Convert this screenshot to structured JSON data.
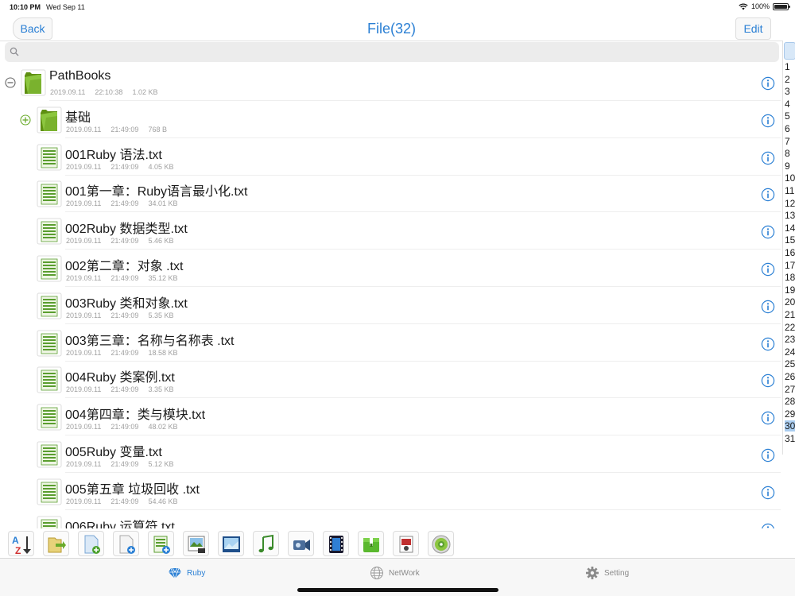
{
  "status": {
    "time": "10:10 PM",
    "date": "Wed Sep 11",
    "battery": "100%",
    "battery_level": 1.0
  },
  "nav": {
    "back_label": "Back",
    "title": "File(32)",
    "edit_label": "Edit"
  },
  "search": {
    "placeholder": ""
  },
  "colors": {
    "accent": "#2a7fd4",
    "folder_green": "#7cb518",
    "file_green": "#5a9e2f",
    "toggle_green": "#6aab2c"
  },
  "items": [
    {
      "kind": "folder",
      "toggle": "collapse",
      "name": "PathBooks",
      "date": "2019.09.11",
      "time": "22:10:38",
      "size": "1.02 KB",
      "level": 0
    },
    {
      "kind": "folder",
      "toggle": "expand",
      "name": "基础",
      "date": "2019.09.11",
      "time": "21:49:09",
      "size": "768 B",
      "level": 1
    },
    {
      "kind": "file",
      "name": "001Ruby 语法.txt",
      "date": "2019.09.11",
      "time": "21:49:09",
      "size": "4.05 KB",
      "level": 1
    },
    {
      "kind": "file",
      "name": "001第一章：Ruby语言最小化.txt",
      "date": "2019.09.11",
      "time": "21:49:09",
      "size": "34.01 KB",
      "level": 1
    },
    {
      "kind": "file",
      "name": "002Ruby 数据类型.txt",
      "date": "2019.09.11",
      "time": "21:49:09",
      "size": "5.46 KB",
      "level": 1
    },
    {
      "kind": "file",
      "name": "002第二章：对象 .txt",
      "date": "2019.09.11",
      "time": "21:49:09",
      "size": "35.12 KB",
      "level": 1
    },
    {
      "kind": "file",
      "name": "003Ruby 类和对象.txt",
      "date": "2019.09.11",
      "time": "21:49:09",
      "size": "5.35 KB",
      "level": 1
    },
    {
      "kind": "file",
      "name": "003第三章：名称与名称表 .txt",
      "date": "2019.09.11",
      "time": "21:49:09",
      "size": "18.58 KB",
      "level": 1
    },
    {
      "kind": "file",
      "name": "004Ruby 类案例.txt",
      "date": "2019.09.11",
      "time": "21:49:09",
      "size": "3.35 KB",
      "level": 1
    },
    {
      "kind": "file",
      "name": "004第四章：类与模块.txt",
      "date": "2019.09.11",
      "time": "21:49:09",
      "size": "48.02 KB",
      "level": 1
    },
    {
      "kind": "file",
      "name": "005Ruby 变量.txt",
      "date": "2019.09.11",
      "time": "21:49:09",
      "size": "5.12 KB",
      "level": 1
    },
    {
      "kind": "file",
      "name": "005第五章 垃圾回收 .txt",
      "date": "2019.09.11",
      "time": "21:49:09",
      "size": "54.46 KB",
      "level": 1
    },
    {
      "kind": "file",
      "name": "006Ruby 运算符.txt",
      "date": "",
      "time": "",
      "size": "",
      "level": 1
    }
  ],
  "index": {
    "labels": [
      "1",
      "2",
      "3",
      "4",
      "5",
      "6",
      "7",
      "8",
      "9",
      "10",
      "11",
      "12",
      "13",
      "14",
      "15",
      "16",
      "17",
      "18",
      "19",
      "20",
      "21",
      "22",
      "23",
      "24",
      "25",
      "26",
      "27",
      "28",
      "29",
      "30",
      "31"
    ],
    "selected": "30"
  },
  "toolbar": [
    {
      "icon": "sort-az-icon"
    },
    {
      "icon": "move-files-icon"
    },
    {
      "icon": "new-file-icon"
    },
    {
      "icon": "new-document-icon"
    },
    {
      "icon": "add-text-file-icon"
    },
    {
      "icon": "photo-image-icon"
    },
    {
      "icon": "picture-frame-icon"
    },
    {
      "icon": "music-note-icon"
    },
    {
      "icon": "video-camera-icon"
    },
    {
      "icon": "film-icon"
    },
    {
      "icon": "archive-zip-icon"
    },
    {
      "icon": "document-viewer-icon"
    },
    {
      "icon": "settings-disc-icon"
    }
  ],
  "tabs": [
    {
      "label": "Ruby",
      "icon": "ruby-gem-icon",
      "active": true
    },
    {
      "label": "NetWork",
      "icon": "globe-icon",
      "active": false
    },
    {
      "label": "Setting",
      "icon": "gear-icon",
      "active": false
    }
  ]
}
